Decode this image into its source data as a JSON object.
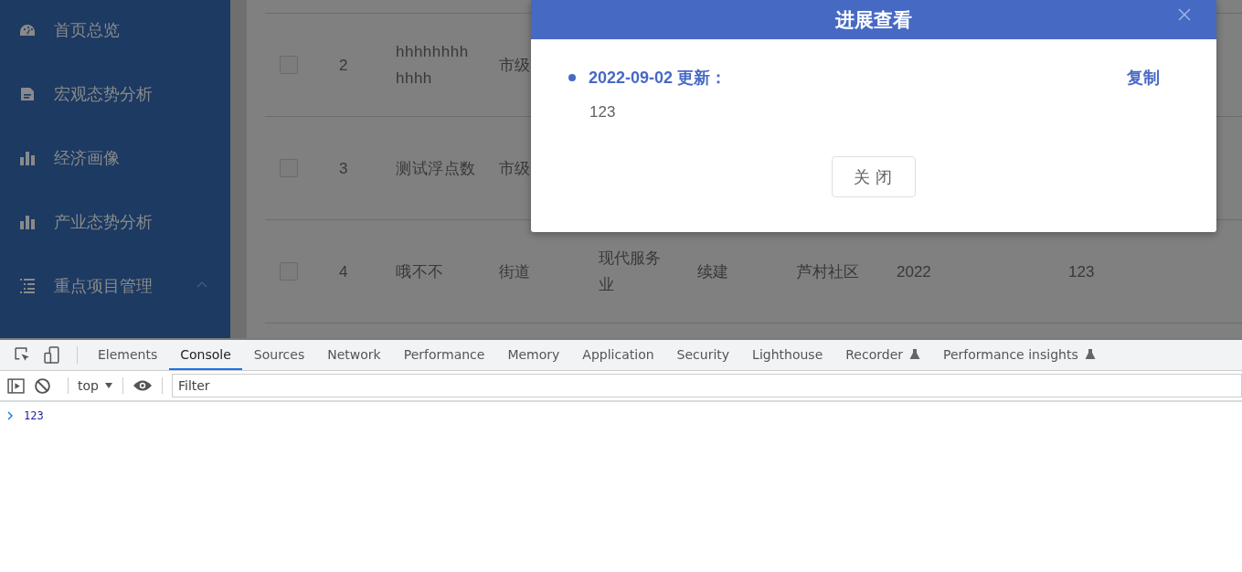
{
  "sidebar": {
    "items": [
      {
        "label": "首页总览",
        "kind": "gauge",
        "expanded": false
      },
      {
        "label": "宏观态势分析",
        "kind": "document",
        "expanded": false
      },
      {
        "label": "经济画像",
        "kind": "chart",
        "expanded": false
      },
      {
        "label": "产业态势分析",
        "kind": "chart",
        "expanded": false
      },
      {
        "label": "重点项目管理",
        "kind": "list",
        "expanded": true
      }
    ]
  },
  "table": {
    "rows": [
      {
        "checked": false,
        "cells": [
          "2",
          "hhhhhhhhhhhh",
          "市级"
        ]
      },
      {
        "checked": false,
        "cells": [
          "3",
          "测试浮点数",
          "市级"
        ]
      },
      {
        "checked": false,
        "cells": [
          "4",
          "哦不不",
          "街道",
          "现代服务业",
          "续建",
          "芦村社区",
          "2022",
          "123"
        ]
      }
    ]
  },
  "dialog": {
    "title": "进展查看",
    "entries": [
      {
        "heading": "2022-09-02 更新：",
        "action": "复制",
        "text": "123"
      }
    ],
    "button": "关闭"
  },
  "devtools": {
    "tabs": [
      {
        "label": "Elements",
        "selected": false,
        "experimental": false
      },
      {
        "label": "Console",
        "selected": true,
        "experimental": false
      },
      {
        "label": "Sources",
        "selected": false,
        "experimental": false
      },
      {
        "label": "Network",
        "selected": false,
        "experimental": false
      },
      {
        "label": "Performance",
        "selected": false,
        "experimental": false
      },
      {
        "label": "Memory",
        "selected": false,
        "experimental": false
      },
      {
        "label": "Application",
        "selected": false,
        "experimental": false
      },
      {
        "label": "Security",
        "selected": false,
        "experimental": false
      },
      {
        "label": "Lighthouse",
        "selected": false,
        "experimental": false
      },
      {
        "label": "Recorder",
        "selected": false,
        "experimental": true
      },
      {
        "label": "Performance insights",
        "selected": false,
        "experimental": true
      }
    ],
    "context": "top",
    "filter_placeholder": "Filter",
    "console": [
      {
        "text": "123"
      }
    ]
  }
}
